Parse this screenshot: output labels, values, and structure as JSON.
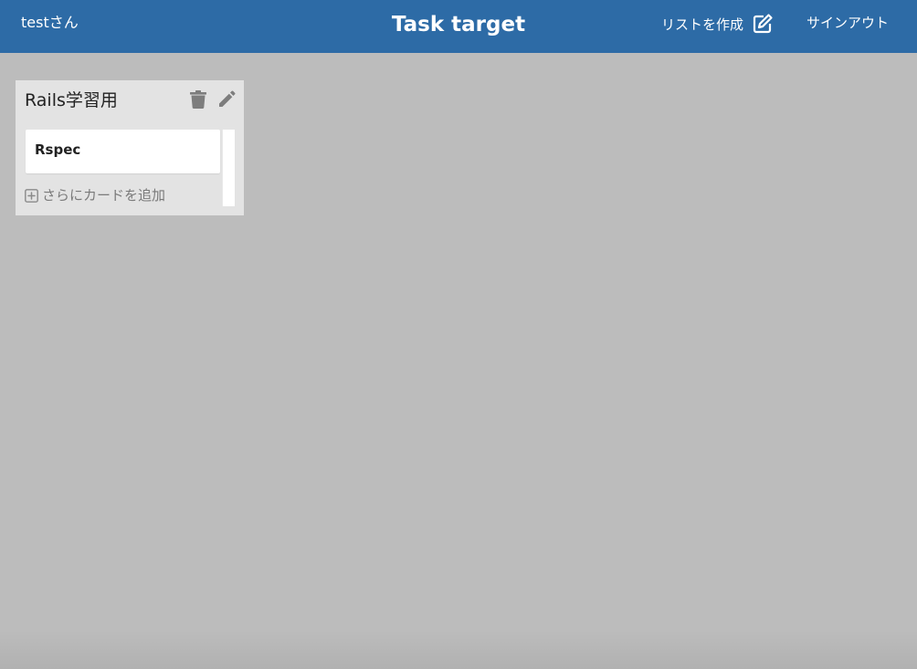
{
  "header": {
    "user_label": "testさん",
    "app_title": "Task target",
    "create_list_label": "リストを作成",
    "sign_out_label": "サインアウト",
    "background_color": "#2d6ba6"
  },
  "icons": {
    "create_list": "edit-icon",
    "delete_list": "trash-icon",
    "edit_list": "pencil-icon",
    "add_card": "plus-square-icon"
  },
  "lists": [
    {
      "title": "Rails学習用",
      "cards": [
        {
          "title": "Rspec"
        }
      ],
      "add_card_label": "さらにカードを追加"
    }
  ],
  "colors": {
    "page_background": "#bcbcbc",
    "list_background": "#e3e3e3",
    "card_background": "#ffffff",
    "muted_text": "#7a7a7a"
  }
}
